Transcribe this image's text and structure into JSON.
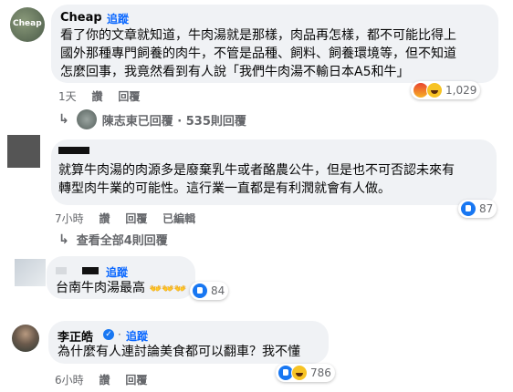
{
  "comments": [
    {
      "author": "Cheap",
      "avatar_text": "Cheap",
      "follow": "追蹤",
      "lines": [
        "看了你的文章就知道，牛肉湯就是那樣，肉品再怎樣，都不可能比得上",
        "國外那種專門飼養的肉牛，不管是品種、飼料、飼養環境等，但不知道",
        "怎麼回事，我竟然看到有人說「我們牛肉湯不輸日本A5和牛」"
      ],
      "time": "1天",
      "like": "讚",
      "reply": "回覆",
      "reactions": [
        "angry-icon",
        "haha-icon"
      ],
      "reaction_count": "1,029",
      "reply_summary": "陳志東已回覆 · 535則回覆"
    },
    {
      "author": "",
      "lines": [
        "就算牛肉湯的肉源多是廢棄乳牛或者酪農公牛，但是也不可否認未來有",
        "轉型肉牛業的可能性。這行業一直都是有利潤就會有人做。"
      ],
      "time": "7小時",
      "like": "讚",
      "reply": "回覆",
      "edited": "已編輯",
      "reactions": [
        "like-icon"
      ],
      "reaction_count": "87",
      "view_replies": "查看全部4則回覆"
    },
    {
      "author": "",
      "follow": "追蹤",
      "text": "台南牛肉湯最高",
      "emojis": "👐👐👐",
      "reactions": [
        "like-icon"
      ],
      "reaction_count": "84"
    },
    {
      "author": "李正皓",
      "follow": "追蹤",
      "text": "為什麼有人連討論美食都可以翻車？我不懂",
      "time": "6小時",
      "like": "讚",
      "reply": "回覆",
      "reactions": [
        "like-icon",
        "haha-icon"
      ],
      "reaction_count": "786"
    }
  ],
  "colors": {
    "bubble": "#f0f2f5",
    "link": "#0866ff",
    "meta": "#65676b",
    "like": "#1877f2"
  }
}
